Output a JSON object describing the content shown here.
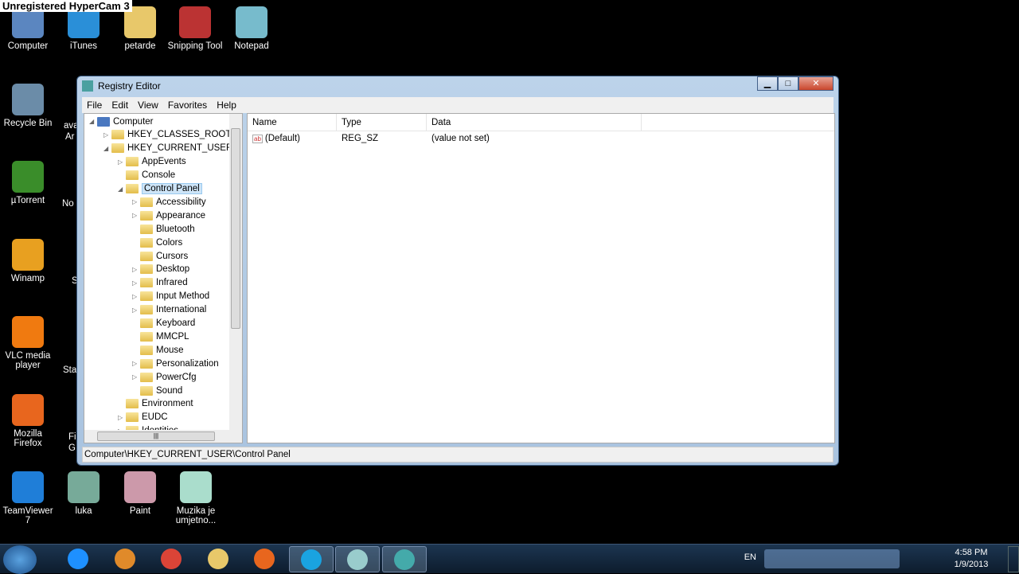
{
  "watermark": "Unregistered HyperCam 3",
  "desktop": {
    "top_row": [
      "iTunes",
      "petarde",
      "Snipping Tool",
      "Notepad"
    ],
    "left_col": [
      "Computer",
      "Recycle Bin",
      "µTorrent",
      "Winamp",
      "VLC media player",
      "Mozilla Firefox",
      "TeamViewer 7"
    ],
    "partial": [
      "ava",
      "Ar",
      "No",
      "S",
      "Sta",
      "Fi",
      "G"
    ],
    "bottom_row": [
      "luka",
      "Paint",
      "Muzika je umjetno..."
    ]
  },
  "window": {
    "title": "Registry Editor",
    "controls": [
      "minimize",
      "maximize",
      "close"
    ],
    "menu": [
      "File",
      "Edit",
      "View",
      "Favorites",
      "Help"
    ],
    "tree": [
      {
        "label": "Computer",
        "level": 0,
        "expanded": true
      },
      {
        "label": "HKEY_CLASSES_ROOT",
        "level": 1,
        "expanded": false
      },
      {
        "label": "HKEY_CURRENT_USER",
        "level": 1,
        "expanded": true
      },
      {
        "label": "AppEvents",
        "level": 2,
        "expanded": false
      },
      {
        "label": "Console",
        "level": 2
      },
      {
        "label": "Control Panel",
        "level": 2,
        "expanded": true,
        "selected": true
      },
      {
        "label": "Accessibility",
        "level": 3,
        "expanded": false
      },
      {
        "label": "Appearance",
        "level": 3,
        "expanded": false
      },
      {
        "label": "Bluetooth",
        "level": 3
      },
      {
        "label": "Colors",
        "level": 3
      },
      {
        "label": "Cursors",
        "level": 3
      },
      {
        "label": "Desktop",
        "level": 3,
        "expanded": false
      },
      {
        "label": "Infrared",
        "level": 3,
        "expanded": false
      },
      {
        "label": "Input Method",
        "level": 3,
        "expanded": false
      },
      {
        "label": "International",
        "level": 3,
        "expanded": false
      },
      {
        "label": "Keyboard",
        "level": 3
      },
      {
        "label": "MMCPL",
        "level": 3
      },
      {
        "label": "Mouse",
        "level": 3
      },
      {
        "label": "Personalization",
        "level": 3,
        "expanded": false
      },
      {
        "label": "PowerCfg",
        "level": 3,
        "expanded": false
      },
      {
        "label": "Sound",
        "level": 3
      },
      {
        "label": "Environment",
        "level": 2
      },
      {
        "label": "EUDC",
        "level": 2,
        "expanded": false
      },
      {
        "label": "Identities",
        "level": 2,
        "expanded": false
      }
    ],
    "columns": [
      "Name",
      "Type",
      "Data"
    ],
    "values": [
      {
        "name": "(Default)",
        "type": "REG_SZ",
        "data": "(value not set)"
      }
    ],
    "status": "Computer\\HKEY_CURRENT_USER\\Control Panel"
  },
  "taskbar": {
    "lang": "EN",
    "time": "4:58 PM",
    "date": "1/9/2013",
    "apps": [
      "internet-explorer",
      "media-player",
      "chrome",
      "explorer",
      "firefox",
      "skype",
      "notepad",
      "registry-editor"
    ]
  }
}
